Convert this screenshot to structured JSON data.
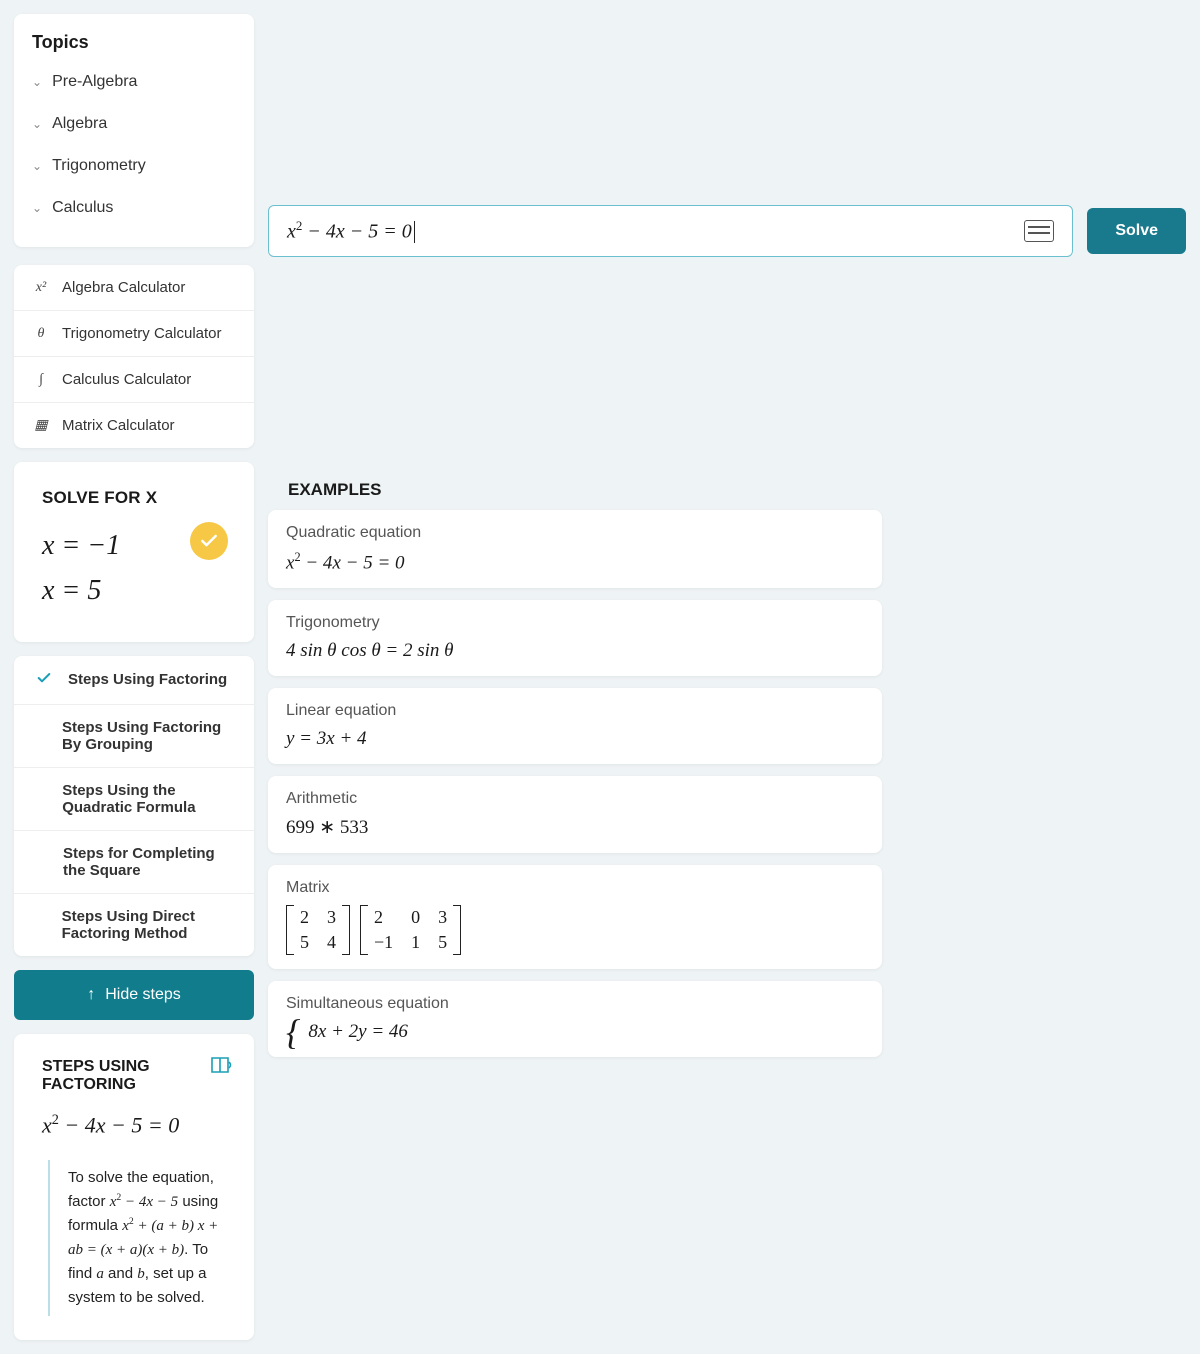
{
  "sidebar": {
    "title": "Topics",
    "topics": [
      {
        "label": "Pre-Algebra"
      },
      {
        "label": "Algebra"
      },
      {
        "label": "Trigonometry"
      },
      {
        "label": "Calculus"
      }
    ],
    "tools": [
      {
        "icon": "x²",
        "label": "Algebra Calculator"
      },
      {
        "icon": "θ",
        "label": "Trigonometry Calculator"
      },
      {
        "icon": "∫",
        "label": "Calculus Calculator"
      },
      {
        "icon": "▦",
        "label": "Matrix Calculator"
      }
    ]
  },
  "input": {
    "equation_html": "x² − 4x − 5 = 0",
    "solve_label": "Solve"
  },
  "solve": {
    "heading": "SOLVE FOR X",
    "solution1": "x = −1",
    "solution2": "x = 5"
  },
  "step_methods": [
    {
      "label": "Steps Using Factoring",
      "selected": true
    },
    {
      "label": "Steps Using Factoring By Grouping",
      "selected": false
    },
    {
      "label": "Steps Using the Quadratic Formula",
      "selected": false
    },
    {
      "label": "Steps for Completing the Square",
      "selected": false
    },
    {
      "label": "Steps Using Direct Factoring Method",
      "selected": false
    }
  ],
  "hide_steps_label": "Hide steps",
  "detail": {
    "heading": "STEPS USING FACTORING",
    "equation": "x² − 4x − 5 = 0",
    "explain_pre": "To solve the equation, factor ",
    "explain_m1": "x² − 4x − 5",
    "explain_mid": " using formula ",
    "explain_m2": "x² + (a + b) x + ab = (x + a)(x + b)",
    "explain_post1": ". To find ",
    "explain_a": "a",
    "explain_and": " and ",
    "explain_b": "b",
    "explain_post2": ", set up a system to be solved."
  },
  "examples": {
    "title": "EXAMPLES",
    "items": [
      {
        "label": "Quadratic equation",
        "math": "x² − 4x − 5 = 0"
      },
      {
        "label": "Trigonometry",
        "math": "4 sin θ cos θ = 2 sin θ"
      },
      {
        "label": "Linear equation",
        "math": "y = 3x + 4"
      },
      {
        "label": "Arithmetic",
        "math": "699 ∗ 533"
      },
      {
        "label": "Matrix",
        "m1": [
          [
            "2",
            "3"
          ],
          [
            "5",
            "4"
          ]
        ],
        "m2": [
          [
            "2",
            "0",
            "3"
          ],
          [
            "−1",
            "1",
            "5"
          ]
        ]
      },
      {
        "label": "Simultaneous equation",
        "math": "8x + 2y = 46"
      }
    ]
  }
}
